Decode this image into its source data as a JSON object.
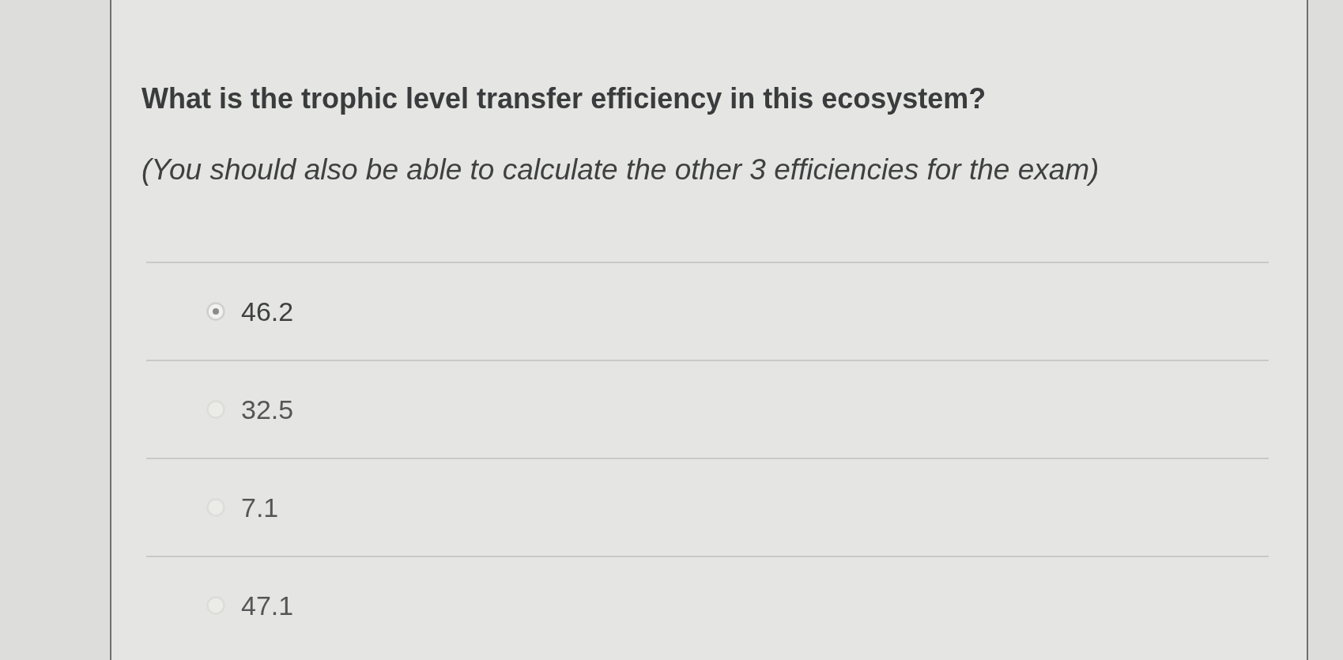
{
  "question": {
    "title": "What is the trophic level transfer efficiency in this ecosystem?",
    "note": "(You should also be able to calculate the other 3 efficiencies for the exam)"
  },
  "options": [
    {
      "label": "46.2",
      "selected": true
    },
    {
      "label": "32.5",
      "selected": false
    },
    {
      "label": "7.1",
      "selected": false
    },
    {
      "label": "47.1",
      "selected": false
    }
  ]
}
